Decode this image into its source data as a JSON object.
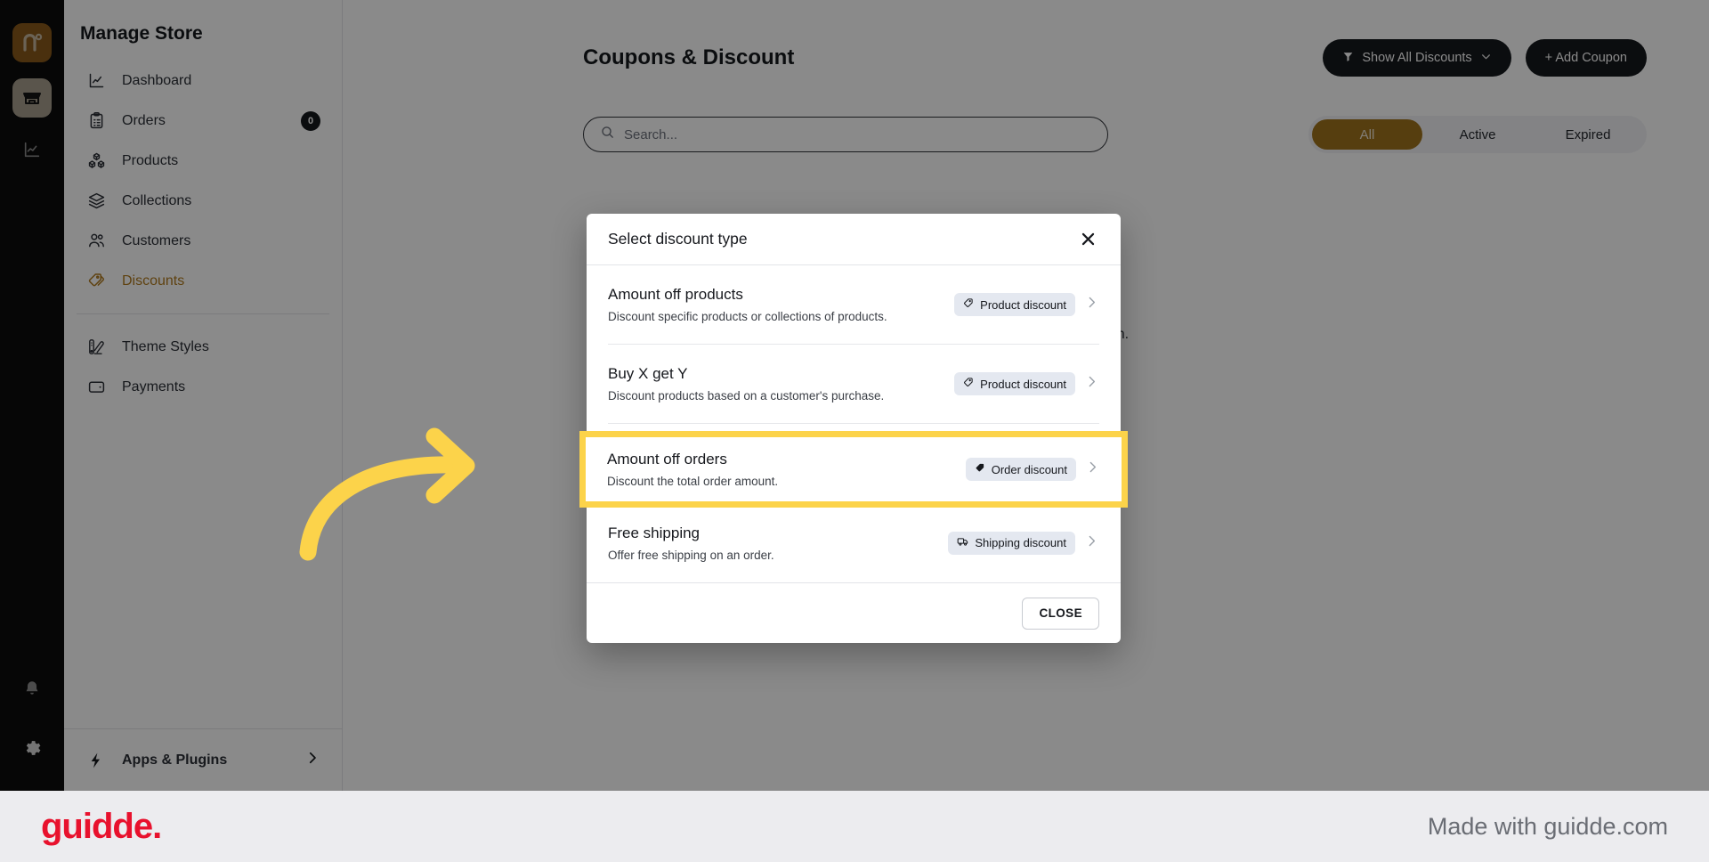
{
  "rail": {
    "logo_label": "n",
    "items": [
      {
        "name": "store-icon",
        "label": "Store",
        "active": true
      },
      {
        "name": "analytics-icon",
        "label": "Analytics",
        "active": false
      }
    ],
    "bottom_items": [
      {
        "name": "bell-icon",
        "label": "Notifications"
      },
      {
        "name": "gear-icon",
        "label": "Settings"
      }
    ]
  },
  "sidebar": {
    "title": "Manage Store",
    "items": [
      {
        "label": "Dashboard",
        "icon": "chart-icon",
        "badge": null,
        "active": false
      },
      {
        "label": "Orders",
        "icon": "clipboard-icon",
        "badge": "0",
        "active": false
      },
      {
        "label": "Products",
        "icon": "boxes-icon",
        "badge": null,
        "active": false
      },
      {
        "label": "Collections",
        "icon": "layers-icon",
        "badge": null,
        "active": false
      },
      {
        "label": "Customers",
        "icon": "users-icon",
        "badge": null,
        "active": false
      },
      {
        "label": "Discounts",
        "icon": "tag-icon",
        "badge": null,
        "active": true
      }
    ],
    "items2": [
      {
        "label": "Theme Styles",
        "icon": "palette-icon"
      },
      {
        "label": "Payments",
        "icon": "wallet-icon"
      }
    ],
    "footer_item": {
      "label": "Apps & Plugins",
      "icon": "bolt-icon"
    }
  },
  "header": {
    "title": "Coupons & Discount",
    "filter_button": "Show All Discounts",
    "add_button": "+ Add Coupon"
  },
  "toolbar": {
    "search_placeholder": "Search...",
    "search_value": "",
    "tabs": [
      {
        "label": "All",
        "selected": true
      },
      {
        "label": "Active",
        "selected": false
      },
      {
        "label": "Expired",
        "selected": false
      }
    ]
  },
  "background_note": "pon.",
  "modal": {
    "title": "Select discount type",
    "close_icon": "close-icon",
    "options": [
      {
        "title": "Amount off products",
        "subtitle": "Discount specific products or collections of products.",
        "tag": "Product discount",
        "tag_icon": "tag-outline-icon"
      },
      {
        "title": "Buy X get Y",
        "subtitle": "Discount products based on a customer's purchase.",
        "tag": "Product discount",
        "tag_icon": "tag-outline-icon"
      },
      {
        "title": "Amount off orders",
        "subtitle": "Discount the total order amount.",
        "tag": "Order discount",
        "tag_icon": "tag-filled-icon",
        "highlighted": true
      },
      {
        "title": "Free shipping",
        "subtitle": "Offer free shipping on an order.",
        "tag": "Shipping discount",
        "tag_icon": "truck-icon"
      }
    ],
    "close_button": "CLOSE"
  },
  "footer": {
    "brand": "guidde.",
    "made_with": "Made with guidde.com"
  },
  "colors": {
    "accent_gold": "#a0731d",
    "logo_gold": "#8a5a1a",
    "discounts_active": "#b07a1e",
    "highlight_yellow": "#FCD34A",
    "dark_button": "#16181d",
    "brand_red": "#e8112d",
    "tag_bg": "#e4e8f0"
  }
}
